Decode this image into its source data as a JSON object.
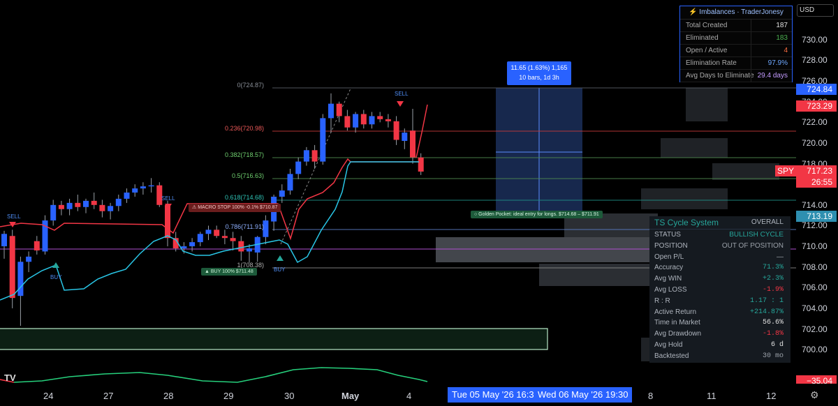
{
  "currency": "USD",
  "symbol": "SPY",
  "colors": {
    "bull": "#2962ff",
    "bear": "#f23645",
    "green": "#26a69a"
  },
  "price_ticks": [
    "730.00",
    "728.00",
    "726.00",
    "724.00",
    "722.00",
    "720.00",
    "718.00",
    "716.00",
    "714.00",
    "712.00",
    "710.00",
    "708.00",
    "706.00",
    "704.00",
    "702.00",
    "700.00"
  ],
  "price_labels": {
    "top": "724.84",
    "red": "723.29",
    "current": "717.23",
    "countdown": "26:55",
    "cyan": "713.19",
    "osc": "−35.04"
  },
  "fib_levels": [
    {
      "label": "0(724.87)",
      "color": "#8a8f98"
    },
    {
      "label": "0.236(720.98)",
      "color": "#f05a5a"
    },
    {
      "label": "0.382(718.57)",
      "color": "#6fcf6f"
    },
    {
      "label": "0.5(716.63)",
      "color": "#6fcf6f"
    },
    {
      "label": "0.618(714.68)",
      "color": "#2ec4b6"
    },
    {
      "label": "0.786(711.91)",
      "color": "#8fb0ff"
    },
    {
      "label": "1(708.38)",
      "color": "#b0b0b0"
    }
  ],
  "signals": {
    "sell": "SELL",
    "buy": "BUY"
  },
  "annotations": {
    "macro_stop": "⚠ MACRO STOP 100%   -0.1%   $710.87",
    "buy_flag": "▲ BUY 100%   $711.48",
    "golden_pocket": "○ Golden Pocket: ideal entry for longs.   $714.68 – $711.91",
    "measure_line1": "11.65 (1.63%) 1,165",
    "measure_line2": "10 bars, 1d 3h"
  },
  "imbalances": {
    "title": "⚡ Imbalances · TraderJonesy",
    "rows": [
      {
        "label": "Total Created",
        "value": "187",
        "color": "#e0e0e0"
      },
      {
        "label": "Eliminated",
        "value": "183",
        "color": "#4caf50"
      },
      {
        "label": "Open / Active",
        "value": "4",
        "color": "#ff7043"
      },
      {
        "label": "Elimination Rate",
        "value": "97.9%",
        "color": "#6ea8ff"
      },
      {
        "label": "Avg Days to Eliminate",
        "value": "29.4 days",
        "color": "#c39bff"
      }
    ]
  },
  "ts_cycle": {
    "title": "TS Cycle System",
    "overall": "OVERALL",
    "rows": [
      {
        "label": "STATUS",
        "value": "BULLISH CYCLE",
        "color": "#26a69a"
      },
      {
        "label": "POSITION",
        "value": "OUT OF POSITION",
        "color": "#9aa0a8"
      },
      {
        "label": "Open P/L",
        "value": "—",
        "color": "#9aa0a8"
      },
      {
        "label": "Accuracy",
        "value": "71.3%",
        "color": "#26a69a"
      },
      {
        "label": "Avg WIN",
        "value": "+2.3%",
        "color": "#26a69a"
      },
      {
        "label": "Avg LOSS",
        "value": "-1.9%",
        "color": "#f23645"
      },
      {
        "label": "R : R",
        "value": "1.17 : 1",
        "color": "#26a69a"
      },
      {
        "label": "Active Return",
        "value": "+214.87%",
        "color": "#26a69a"
      },
      {
        "label": "Time in Market",
        "value": "56.6%",
        "color": "#e0e0e0"
      },
      {
        "label": "Avg Drawdown",
        "value": "-1.8%",
        "color": "#f23645"
      },
      {
        "label": "Avg Hold",
        "value": "6 d",
        "color": "#e0e0e0"
      },
      {
        "label": "Backtested",
        "value": "30 mo",
        "color": "#9aa0a8"
      }
    ]
  },
  "time_labels": [
    "24",
    "27",
    "28",
    "29",
    "30",
    "May",
    "4",
    "8",
    "11",
    "12"
  ],
  "time_chip_1": "Tue 05 May '26   16:3",
  "time_chip_2": "Wed 06 May '26   19:30",
  "chart_data": {
    "type": "candlestick",
    "ylim": [
      699,
      731
    ],
    "candles": [
      {
        "o": 710.0,
        "h": 711.5,
        "l": 708.8,
        "c": 711.2
      },
      {
        "o": 711.0,
        "h": 711.6,
        "l": 704.0,
        "c": 705.0
      },
      {
        "o": 705.2,
        "h": 709.0,
        "l": 702.3,
        "c": 708.5
      },
      {
        "o": 708.5,
        "h": 709.5,
        "l": 707.5,
        "c": 709.0
      },
      {
        "o": 710.5,
        "h": 711.0,
        "l": 709.2,
        "c": 709.6
      },
      {
        "o": 709.5,
        "h": 713.0,
        "l": 709.2,
        "c": 712.5
      },
      {
        "o": 712.5,
        "h": 714.5,
        "l": 712.0,
        "c": 714.0
      },
      {
        "o": 714.0,
        "h": 714.4,
        "l": 713.0,
        "c": 713.6
      },
      {
        "o": 713.6,
        "h": 714.6,
        "l": 713.0,
        "c": 714.2
      },
      {
        "o": 714.2,
        "h": 715.0,
        "l": 713.4,
        "c": 713.8
      },
      {
        "o": 713.8,
        "h": 714.6,
        "l": 713.2,
        "c": 714.4
      },
      {
        "o": 714.4,
        "h": 715.2,
        "l": 713.6,
        "c": 714.0
      },
      {
        "o": 714.0,
        "h": 714.5,
        "l": 712.8,
        "c": 713.4
      },
      {
        "o": 713.4,
        "h": 714.2,
        "l": 712.6,
        "c": 713.9
      },
      {
        "o": 713.9,
        "h": 715.0,
        "l": 713.4,
        "c": 714.6
      },
      {
        "o": 714.6,
        "h": 715.6,
        "l": 714.2,
        "c": 715.2
      },
      {
        "o": 715.2,
        "h": 716.0,
        "l": 714.8,
        "c": 715.6
      },
      {
        "o": 715.6,
        "h": 716.2,
        "l": 715.0,
        "c": 715.8
      },
      {
        "o": 715.8,
        "h": 716.6,
        "l": 715.2,
        "c": 715.9
      },
      {
        "o": 715.9,
        "h": 716.2,
        "l": 713.8,
        "c": 714.0
      },
      {
        "o": 714.0,
        "h": 714.4,
        "l": 710.0,
        "c": 710.8
      },
      {
        "o": 710.8,
        "h": 711.4,
        "l": 709.5,
        "c": 709.8
      },
      {
        "o": 709.8,
        "h": 710.4,
        "l": 709.3,
        "c": 710.0
      },
      {
        "o": 710.0,
        "h": 710.8,
        "l": 709.5,
        "c": 710.4
      },
      {
        "o": 710.4,
        "h": 711.4,
        "l": 710.0,
        "c": 711.2
      },
      {
        "o": 711.2,
        "h": 712.0,
        "l": 710.6,
        "c": 711.6
      },
      {
        "o": 711.6,
        "h": 712.0,
        "l": 710.8,
        "c": 711.0
      },
      {
        "o": 711.0,
        "h": 711.6,
        "l": 710.2,
        "c": 710.8
      },
      {
        "o": 710.8,
        "h": 711.4,
        "l": 709.6,
        "c": 710.5
      },
      {
        "o": 710.5,
        "h": 711.0,
        "l": 708.6,
        "c": 709.5
      },
      {
        "o": 709.5,
        "h": 710.2,
        "l": 708.4,
        "c": 709.8
      },
      {
        "o": 709.4,
        "h": 711.0,
        "l": 708.5,
        "c": 710.9
      },
      {
        "o": 710.9,
        "h": 713.0,
        "l": 710.2,
        "c": 712.5
      },
      {
        "o": 712.4,
        "h": 715.0,
        "l": 711.5,
        "c": 714.8
      },
      {
        "o": 714.8,
        "h": 716.0,
        "l": 714.2,
        "c": 715.4
      },
      {
        "o": 715.4,
        "h": 717.5,
        "l": 715.0,
        "c": 717.0
      },
      {
        "o": 717.0,
        "h": 718.6,
        "l": 716.5,
        "c": 718.2
      },
      {
        "o": 718.2,
        "h": 719.6,
        "l": 717.8,
        "c": 719.3
      },
      {
        "o": 719.3,
        "h": 719.8,
        "l": 717.5,
        "c": 718.2
      },
      {
        "o": 718.2,
        "h": 722.8,
        "l": 717.9,
        "c": 722.4
      },
      {
        "o": 722.4,
        "h": 724.8,
        "l": 721.0,
        "c": 723.8
      },
      {
        "o": 723.8,
        "h": 724.0,
        "l": 722.0,
        "c": 722.6
      },
      {
        "o": 722.6,
        "h": 723.2,
        "l": 721.2,
        "c": 721.5
      },
      {
        "o": 721.5,
        "h": 723.0,
        "l": 721.0,
        "c": 722.8
      },
      {
        "o": 722.8,
        "h": 723.2,
        "l": 721.4,
        "c": 721.8
      },
      {
        "o": 721.8,
        "h": 723.0,
        "l": 721.4,
        "c": 722.6
      },
      {
        "o": 722.6,
        "h": 723.0,
        "l": 722.0,
        "c": 722.3
      },
      {
        "o": 722.3,
        "h": 722.8,
        "l": 721.5,
        "c": 722.1
      },
      {
        "o": 722.1,
        "h": 722.6,
        "l": 719.8,
        "c": 720.3
      },
      {
        "o": 720.2,
        "h": 721.4,
        "l": 719.4,
        "c": 721.0
      },
      {
        "o": 721.2,
        "h": 723.3,
        "l": 718.0,
        "c": 718.6
      },
      {
        "o": 718.6,
        "h": 719.0,
        "l": 716.9,
        "c": 717.23
      }
    ]
  }
}
